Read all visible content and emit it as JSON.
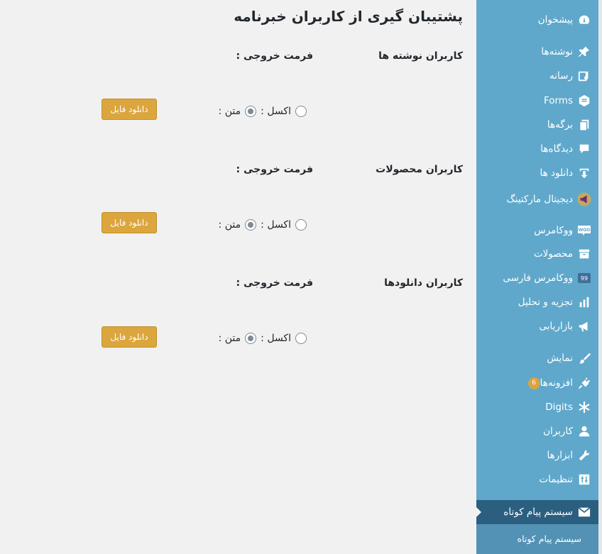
{
  "page": {
    "title": "پشتیبان گیری از کاربران خبرنامه"
  },
  "sections": [
    {
      "title": "کاربران نوشته ها",
      "format_label": "فرمت خروجی :",
      "opt_text": "متن :",
      "opt_excel": "اکسل :",
      "download_label": "دانلود فایل"
    },
    {
      "title": "کاربران محصولات",
      "format_label": "فرمت خروجی :",
      "opt_text": "متن :",
      "opt_excel": "اکسل :",
      "download_label": "دانلود فایل"
    },
    {
      "title": "کاربران دانلودها",
      "format_label": "فرمت خروجی :",
      "opt_text": "متن :",
      "opt_excel": "اکسل :",
      "download_label": "دانلود فایل"
    }
  ],
  "sidebar": {
    "items": [
      {
        "label": "پیشخوان",
        "icon": "dashboard-icon"
      },
      {
        "label": "نوشته‌ها",
        "icon": "pin-icon"
      },
      {
        "label": "رسانه",
        "icon": "media-icon"
      },
      {
        "label": "Forms",
        "icon": "forms-icon"
      },
      {
        "label": "برگه‌ها",
        "icon": "pages-icon"
      },
      {
        "label": "دیدگاه‌ها",
        "icon": "comments-icon"
      },
      {
        "label": "دانلود ها",
        "icon": "download-icon"
      },
      {
        "label": "دیجیتال مارکتینگ",
        "icon": "megaphone-icon"
      },
      {
        "label": "ووکامرس",
        "icon": "woo-icon"
      },
      {
        "label": "محصولات",
        "icon": "archive-icon"
      },
      {
        "label": "ووکامرس فارسی",
        "icon": "woo-persian-icon"
      },
      {
        "label": "تجزیه و تحلیل",
        "icon": "chart-icon"
      },
      {
        "label": "بازاریابی",
        "icon": "marketing-icon"
      },
      {
        "label": "نمایش",
        "icon": "brush-icon"
      },
      {
        "label": "افزونه‌ها",
        "icon": "plugin-icon",
        "badge": "6"
      },
      {
        "label": "Digits",
        "icon": "digits-icon"
      },
      {
        "label": "کاربران",
        "icon": "user-icon"
      },
      {
        "label": "ابزارها",
        "icon": "wrench-icon"
      },
      {
        "label": "تنظیمات",
        "icon": "settings-icon"
      },
      {
        "label": "سیستم پیام کوتاه",
        "icon": "mail-icon"
      }
    ],
    "submenu": [
      {
        "label": "سیستم پیام کوتاه"
      }
    ]
  }
}
